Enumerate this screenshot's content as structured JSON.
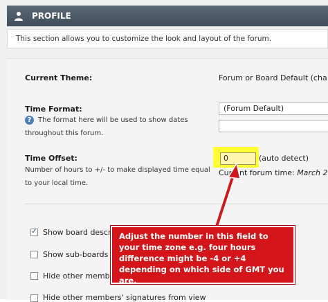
{
  "header": {
    "title": "PROFILE"
  },
  "info": {
    "text": "This section allows you to customize the look and layout of the forum."
  },
  "theme": {
    "label": "Current Theme:",
    "value": "Forum or Board Default (cha"
  },
  "time_format": {
    "label": "Time Format:",
    "help_line1": "The format here will be used to show dates",
    "help_line2": "throughout this forum.",
    "select_value": "(Forum Default)",
    "custom_value": ""
  },
  "time_offset": {
    "label": "Time Offset:",
    "desc_line1": "Number of hours to +/- to make displayed time equal",
    "desc_line2": "to your local time.",
    "input_value": "0",
    "auto_detect": "(auto detect)",
    "current_label": "Current forum time:",
    "current_value": "March 2"
  },
  "options": [
    {
      "label": "Show board descr",
      "checked": true
    },
    {
      "label": "Show sub-boards ",
      "checked": false
    },
    {
      "label": "Hide other membe",
      "checked": false
    },
    {
      "label": "Hide other members' signatures from view",
      "checked": false
    }
  ],
  "callout": {
    "text": "Adjust the number in this field to your time zone e.g. four hours difference might be -4 or +4 depending on which side of GMT you are."
  },
  "colors": {
    "header_bg": "#4a5764",
    "highlight": "#ffff33",
    "callout_bg": "#d4161a",
    "arrow": "#d4161a"
  }
}
